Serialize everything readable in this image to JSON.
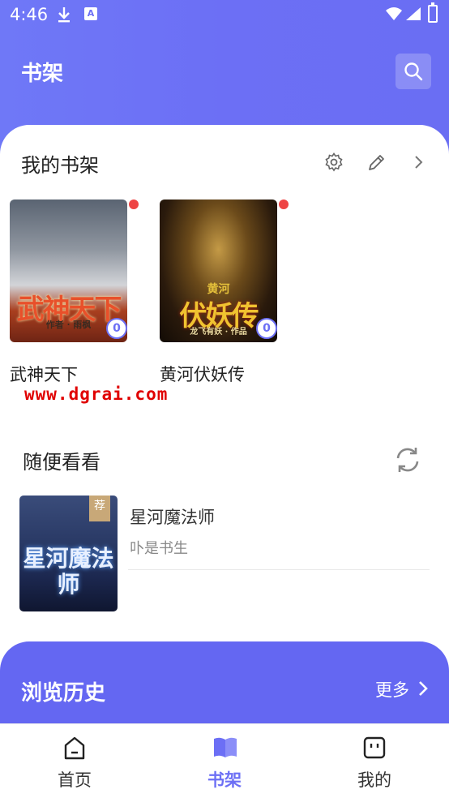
{
  "status_bar": {
    "time": "4:46"
  },
  "header": {
    "title": "书架"
  },
  "my_shelf": {
    "heading": "我的书架",
    "books": [
      {
        "title": "武神天下",
        "cover_text": "武神天下",
        "cover_author": "作者 · 雨枫",
        "unread": "0"
      },
      {
        "title": "黄河伏妖传",
        "cover_top": "黄河",
        "cover_text": "伏妖传",
        "cover_sub": "龙飞有妖 · 作品",
        "unread": "0"
      }
    ]
  },
  "watermark": "www.dgrai.com",
  "random": {
    "heading": "随便看看",
    "items": [
      {
        "tag": "荐",
        "cover_text": "星河魔法师",
        "title": "星河魔法师",
        "author": "卟是书生"
      }
    ]
  },
  "history": {
    "title": "浏览历史",
    "more": "更多"
  },
  "tabbar": [
    {
      "label": "首页"
    },
    {
      "label": "书架"
    },
    {
      "label": "我的"
    }
  ],
  "colors": {
    "accent": "#6c6ff5",
    "history_bg": "#6467f2",
    "dot": "#ee4444"
  }
}
